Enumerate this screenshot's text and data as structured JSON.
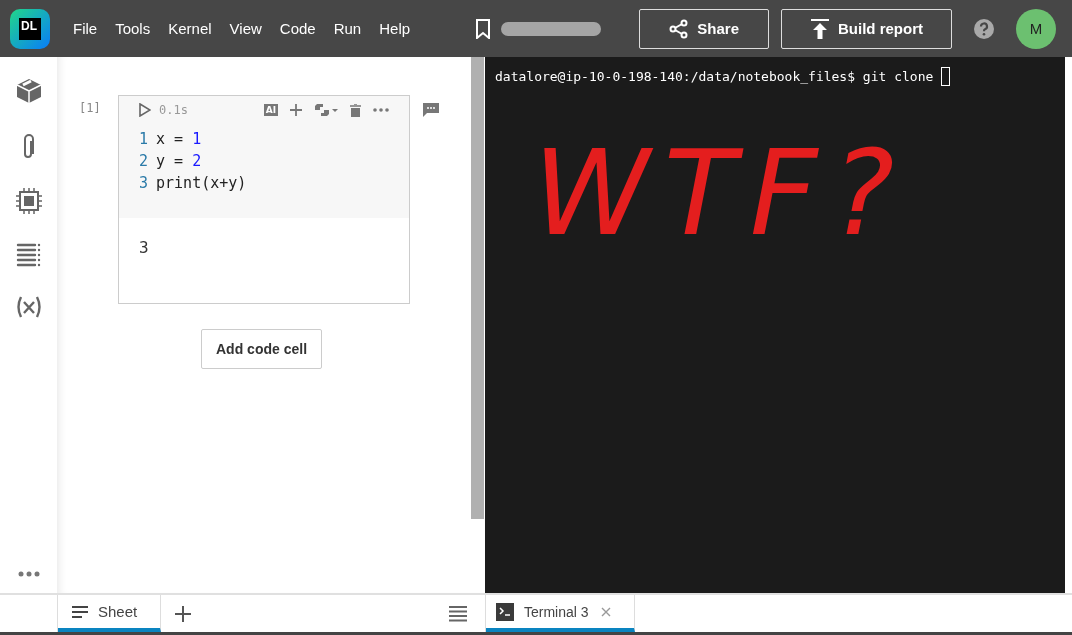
{
  "menu": [
    "File",
    "Tools",
    "Kernel",
    "View",
    "Code",
    "Run",
    "Help"
  ],
  "logo": "DL",
  "actions": [
    {
      "kind": "share",
      "label": "Share"
    },
    {
      "kind": "report",
      "label": "Build report"
    }
  ],
  "avatar": "M",
  "cell": {
    "index": "[1]",
    "time": "0.1s",
    "ai_label": "AI",
    "lines": [
      {
        "number": "1",
        "code": "x = ",
        "value": "1"
      },
      {
        "number": "2",
        "code": "y = ",
        "value": "2"
      },
      {
        "number": "3",
        "code": "print(x+y)"
      }
    ],
    "output": "3"
  },
  "add_cell": "Add code cell",
  "terminal": {
    "prompt": "datalore@ip-10-0-198-140:/data/notebook_files$ git clone ",
    "annotation": "WTF?"
  },
  "tabs": [
    {
      "label": "Sheet",
      "selected": true,
      "kind": "sheet"
    },
    {
      "label": "Terminal 3",
      "selected": true,
      "kind": "terminal"
    }
  ]
}
